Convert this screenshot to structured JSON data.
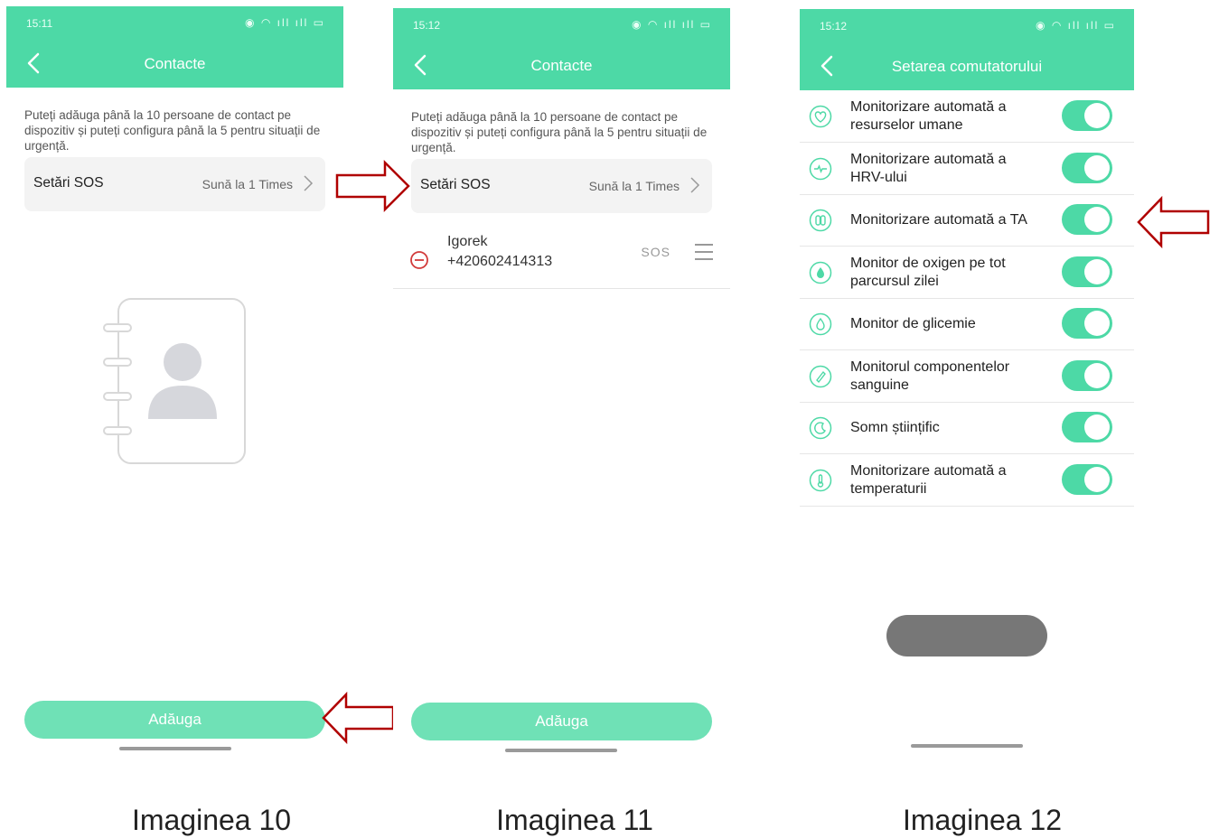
{
  "screen1": {
    "status_time": "15:11",
    "title": "Contacte",
    "info": "Puteți adăuga până la 10 persoane de contact pe dispozitiv și puteți configura până la 5 pentru situații de urgență.",
    "sos_label": "Setări SOS",
    "sos_value": "Sună la 1 Times",
    "add_button": "Adăuga",
    "caption": "Imaginea 10"
  },
  "screen2": {
    "status_time": "15:12",
    "title": "Contacte",
    "info": "Puteți adăuga până la 10 persoane de contact pe dispozitiv și puteți configura până la 5 pentru situații de urgență.",
    "sos_label": "Setări SOS",
    "sos_value": "Sună la 1 Times",
    "contact": {
      "name": "Igorek",
      "phone": "+420602414313",
      "badge": "SOS"
    },
    "add_button": "Adăuga",
    "caption": "Imaginea 11"
  },
  "screen3": {
    "status_time": "15:12",
    "title": "Setarea comutatorului",
    "settings": [
      {
        "label": "Monitorizare automată a resurselor umane",
        "icon": "heart-icon",
        "enabled": true
      },
      {
        "label": "Monitorizare automată a HRV-ului",
        "icon": "hrv-icon",
        "enabled": true
      },
      {
        "label": "Monitorizare automată a TA",
        "icon": "blood-pressure-icon",
        "enabled": true
      },
      {
        "label": "Monitor de oxigen pe tot parcursul zilei",
        "icon": "oxygen-icon",
        "enabled": true
      },
      {
        "label": "Monitor de glicemie",
        "icon": "glucose-icon",
        "enabled": true
      },
      {
        "label": "Monitorul componentelor sanguine",
        "icon": "blood-components-icon",
        "enabled": true
      },
      {
        "label": "Somn științific",
        "icon": "sleep-icon",
        "enabled": true
      },
      {
        "label": "Monitorizare automată a temperaturii",
        "icon": "thermometer-icon",
        "enabled": true
      }
    ],
    "caption": "Imaginea 12"
  },
  "colors": {
    "accent": "#4dd9a6",
    "arrow": "#b00000",
    "button": "#6fe1b6"
  }
}
